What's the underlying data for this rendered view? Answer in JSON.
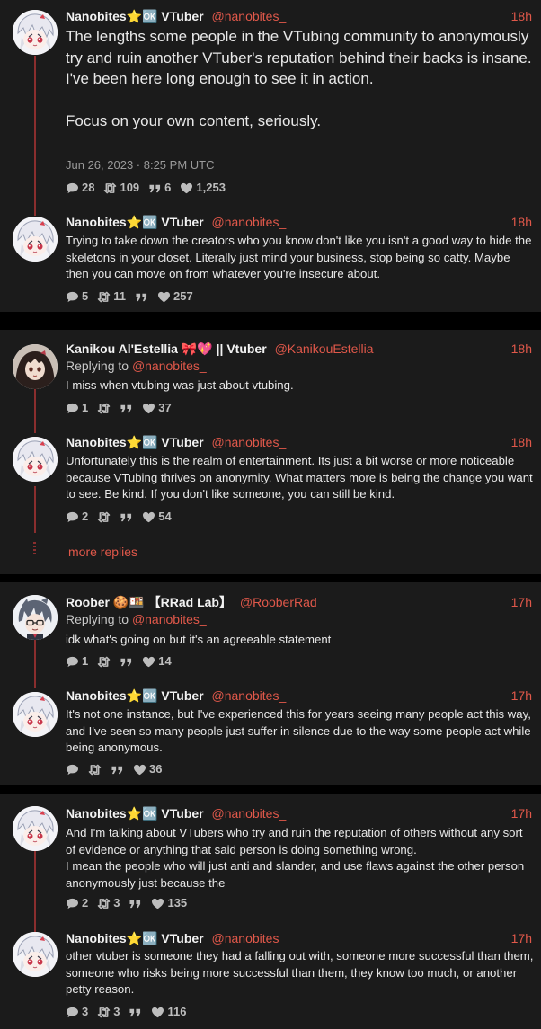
{
  "colors": {
    "accent": "#e0584a",
    "thread_line": "#8a2e2e",
    "card_bg": "#1b1b1b",
    "page_bg": "#000000"
  },
  "badges": [
    "star-emoji",
    "vtuber-emoji",
    "ribbon-emoji",
    "heart-emoji",
    "cookie-emoji"
  ],
  "threads": [
    {
      "posts": [
        {
          "name": "Nanobites⭐🆗 VTuber",
          "handle": "@nanobites_",
          "time": "18h",
          "text": "The lengths some people in the VTubing community to anonymously try and ruin another VTuber's reputation behind their backs is insane.\nI've been here long enough to see it in action.\n\nFocus on your own content, seriously.",
          "date": "Jun 26, 2023 · 8:25 PM UTC",
          "stats": {
            "replies": "28",
            "retweets": "109",
            "quotes": "6",
            "likes": "1,253"
          }
        },
        {
          "name": "Nanobites⭐🆗 VTuber",
          "handle": "@nanobites_",
          "time": "18h",
          "text": "Trying to take down the creators who you know don't like you isn't a good way to hide the skeletons in your closet. Literally just mind your business, stop being so catty. Maybe then you can move on from whatever you're insecure about.",
          "stats": {
            "replies": "5",
            "retweets": "11",
            "quotes": "",
            "likes": "257"
          }
        }
      ]
    },
    {
      "posts": [
        {
          "name": "Kanikou Al'Estellia 🎀💖 || Vtuber",
          "handle": "@KanikouEstellia",
          "time": "18h",
          "replying_label": "Replying to ",
          "replying_to": "@nanobites_",
          "text": "I miss when vtubing was just about vtubing.",
          "stats": {
            "replies": "1",
            "retweets": "",
            "quotes": "",
            "likes": "37"
          }
        },
        {
          "name": "Nanobites⭐🆗 VTuber",
          "handle": "@nanobites_",
          "time": "18h",
          "text": "Unfortunately this is the realm of entertainment. Its just a bit worse or more noticeable because VTubing thrives on anonymity. What matters more is being the change you want to see. Be kind. If you don't like someone, you can still be kind.",
          "stats": {
            "replies": "2",
            "retweets": "",
            "quotes": "",
            "likes": "54"
          }
        }
      ],
      "more_replies": "more replies"
    },
    {
      "posts": [
        {
          "name": "Roober 🍪🍱 【RRad Lab】",
          "handle": "@RooberRad",
          "time": "17h",
          "replying_label": "Replying to ",
          "replying_to": "@nanobites_",
          "text": "idk what's going on but it's an agreeable statement",
          "stats": {
            "replies": "1",
            "retweets": "",
            "quotes": "",
            "likes": "14"
          }
        },
        {
          "name": "Nanobites⭐🆗 VTuber",
          "handle": "@nanobites_",
          "time": "17h",
          "text": "It's not  one instance, but I've experienced this for years seeing many people act this way, and I've seen so many people just suffer in silence due to the way some people act while being anonymous.",
          "stats": {
            "replies": "",
            "retweets": "",
            "quotes": "",
            "likes": "36"
          }
        }
      ]
    },
    {
      "posts": [
        {
          "name": "Nanobites⭐🆗 VTuber",
          "handle": "@nanobites_",
          "time": "17h",
          "text": "And I'm talking about VTubers who try and ruin the reputation of others without any sort of evidence or anything that said person is doing something wrong.\nI mean the people who will just anti and slander, and use flaws against the other person anonymously just because the",
          "stats": {
            "replies": "2",
            "retweets": "3",
            "quotes": "",
            "likes": "135"
          }
        },
        {
          "name": "Nanobites⭐🆗 VTuber",
          "handle": "@nanobites_",
          "time": "17h",
          "text": "other vtuber is someone they had a falling out with, someone more successful than them, someone who risks being more successful than them, they know too much, or another petty reason.",
          "stats": {
            "replies": "3",
            "retweets": "3",
            "quotes": "",
            "likes": "116"
          }
        }
      ]
    }
  ]
}
